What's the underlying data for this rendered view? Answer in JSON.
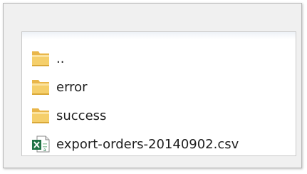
{
  "file_list": {
    "items": [
      {
        "label": "..",
        "icon": "folder-icon",
        "type": "parent-folder"
      },
      {
        "label": "error",
        "icon": "folder-icon",
        "type": "folder"
      },
      {
        "label": "success",
        "icon": "folder-icon",
        "type": "folder"
      },
      {
        "label": "export-orders-20140902.csv",
        "icon": "excel-csv-icon",
        "type": "file"
      }
    ]
  },
  "colors": {
    "folder_yellow": "#f5cf6b",
    "excel_green": "#217346"
  }
}
